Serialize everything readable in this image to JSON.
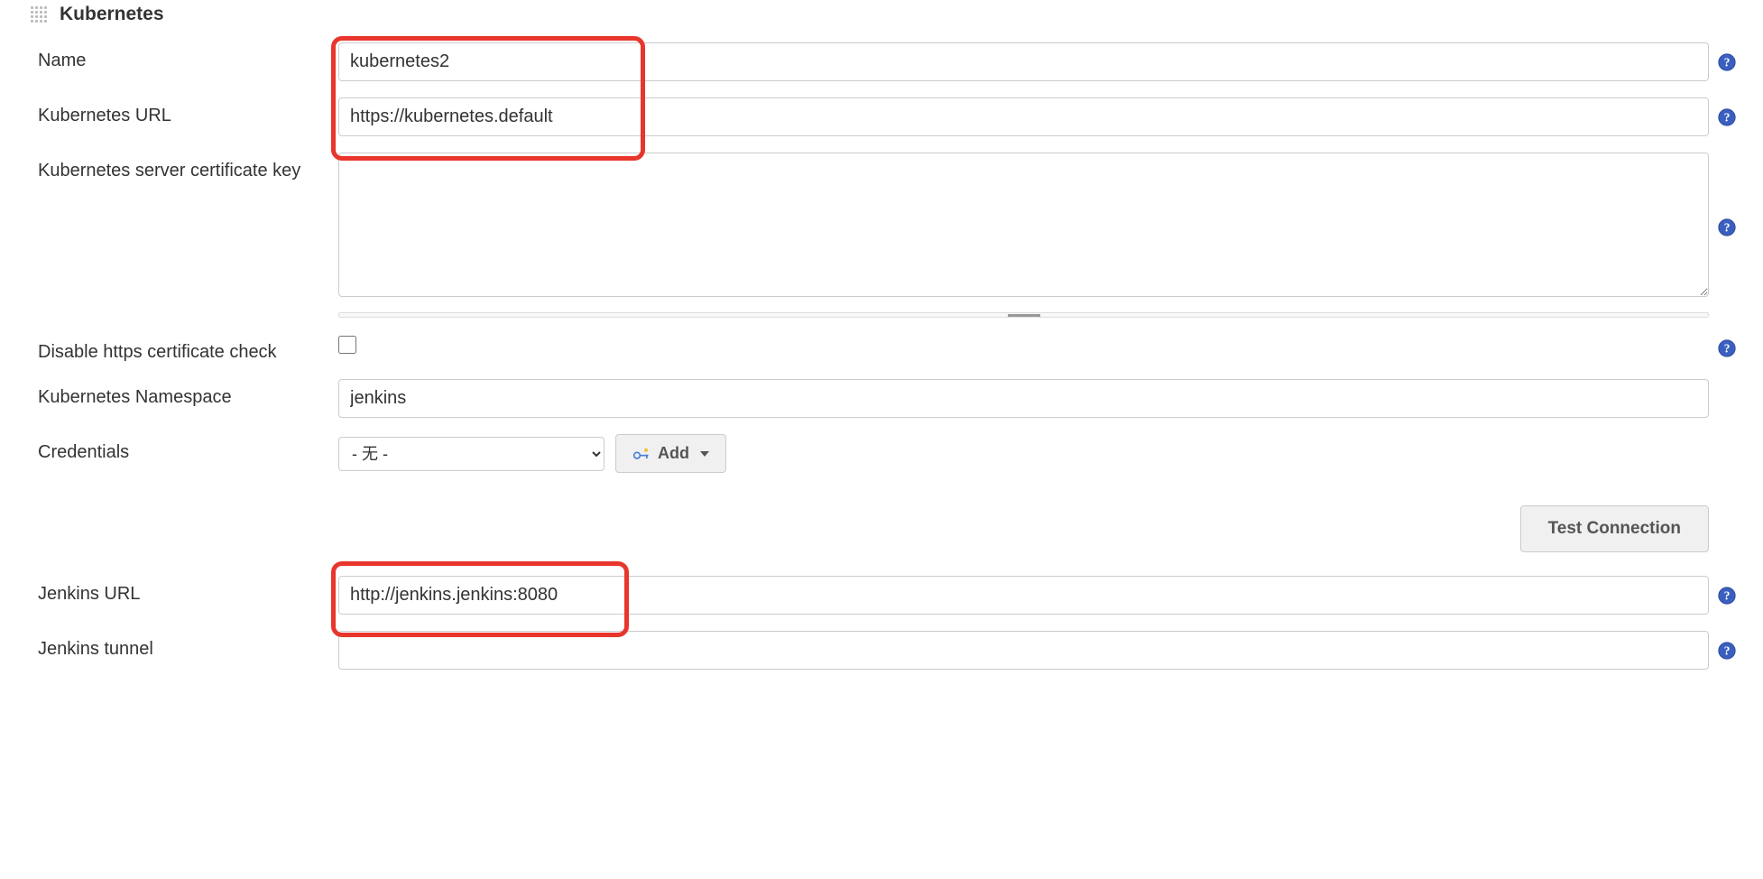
{
  "section": {
    "title": "Kubernetes"
  },
  "fields": {
    "name": {
      "label": "Name",
      "value": "kubernetes2"
    },
    "kubernetesUrl": {
      "label": "Kubernetes URL",
      "value": "https://kubernetes.default"
    },
    "certificateKey": {
      "label": "Kubernetes server certificate key",
      "value": ""
    },
    "disableHttpsCheck": {
      "label": "Disable https certificate check",
      "checked": false
    },
    "namespace": {
      "label": "Kubernetes Namespace",
      "value": "jenkins"
    },
    "credentials": {
      "label": "Credentials",
      "selected": "- 无 -",
      "addLabel": "Add"
    },
    "testConnection": {
      "label": "Test Connection"
    },
    "jenkinsUrl": {
      "label": "Jenkins URL",
      "value": "http://jenkins.jenkins:8080"
    },
    "jenkinsTunnel": {
      "label": "Jenkins tunnel",
      "value": ""
    }
  }
}
